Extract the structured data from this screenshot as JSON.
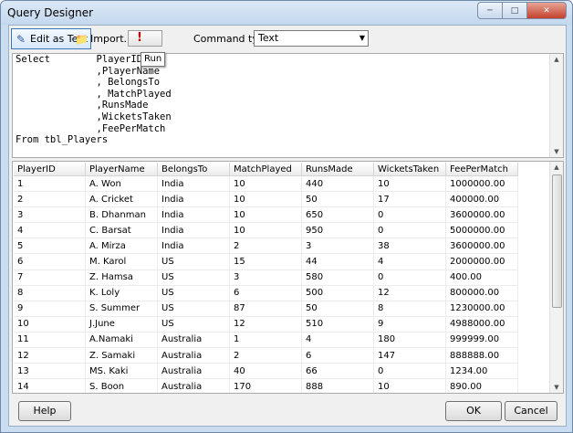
{
  "window": {
    "title": "Query Designer"
  },
  "toolbar": {
    "edit_as_text": "Edit as Text",
    "import": "Import...",
    "run_tooltip": "Run",
    "command_type_label": "Command type:",
    "command_type_value": "Text"
  },
  "sql": {
    "text": "Select        PlayerID\n              ,PlayerName\n              , BelongsTo\n              , MatchPlayed\n              ,RunsMade\n              ,WicketsTaken\n              ,FeePerMatch\nFrom tbl_Players"
  },
  "grid": {
    "columns": [
      "PlayerID",
      "PlayerName",
      "BelongsTo",
      "MatchPlayed",
      "RunsMade",
      "WicketsTaken",
      "FeePerMatch"
    ],
    "rows": [
      [
        "1",
        "A. Won",
        "India",
        "10",
        "440",
        "10",
        "1000000.00"
      ],
      [
        "2",
        "A. Cricket",
        "India",
        "10",
        "50",
        "17",
        "400000.00"
      ],
      [
        "3",
        "B. Dhanman",
        "India",
        "10",
        "650",
        "0",
        "3600000.00"
      ],
      [
        "4",
        "C. Barsat",
        "India",
        "10",
        "950",
        "0",
        "5000000.00"
      ],
      [
        "5",
        "A. Mirza",
        "India",
        "2",
        "3",
        "38",
        "3600000.00"
      ],
      [
        "6",
        "M. Karol",
        "US",
        "15",
        "44",
        "4",
        "2000000.00"
      ],
      [
        "7",
        "Z. Hamsa",
        "US",
        "3",
        "580",
        "0",
        "400.00"
      ],
      [
        "8",
        "K. Loly",
        "US",
        "6",
        "500",
        "12",
        "800000.00"
      ],
      [
        "9",
        "S. Summer",
        "US",
        "87",
        "50",
        "8",
        "1230000.00"
      ],
      [
        "10",
        "J.June",
        "US",
        "12",
        "510",
        "9",
        "4988000.00"
      ],
      [
        "11",
        "A.Namaki",
        "Australia",
        "1",
        "4",
        "180",
        "999999.00"
      ],
      [
        "12",
        "Z. Samaki",
        "Australia",
        "2",
        "6",
        "147",
        "888888.00"
      ],
      [
        "13",
        "MS. Kaki",
        "Australia",
        "40",
        "66",
        "0",
        "1234.00"
      ],
      [
        "14",
        "S. Boon",
        "Australia",
        "170",
        "888",
        "10",
        "890.00"
      ]
    ]
  },
  "footer": {
    "help": "Help",
    "ok": "OK",
    "cancel": "Cancel"
  }
}
